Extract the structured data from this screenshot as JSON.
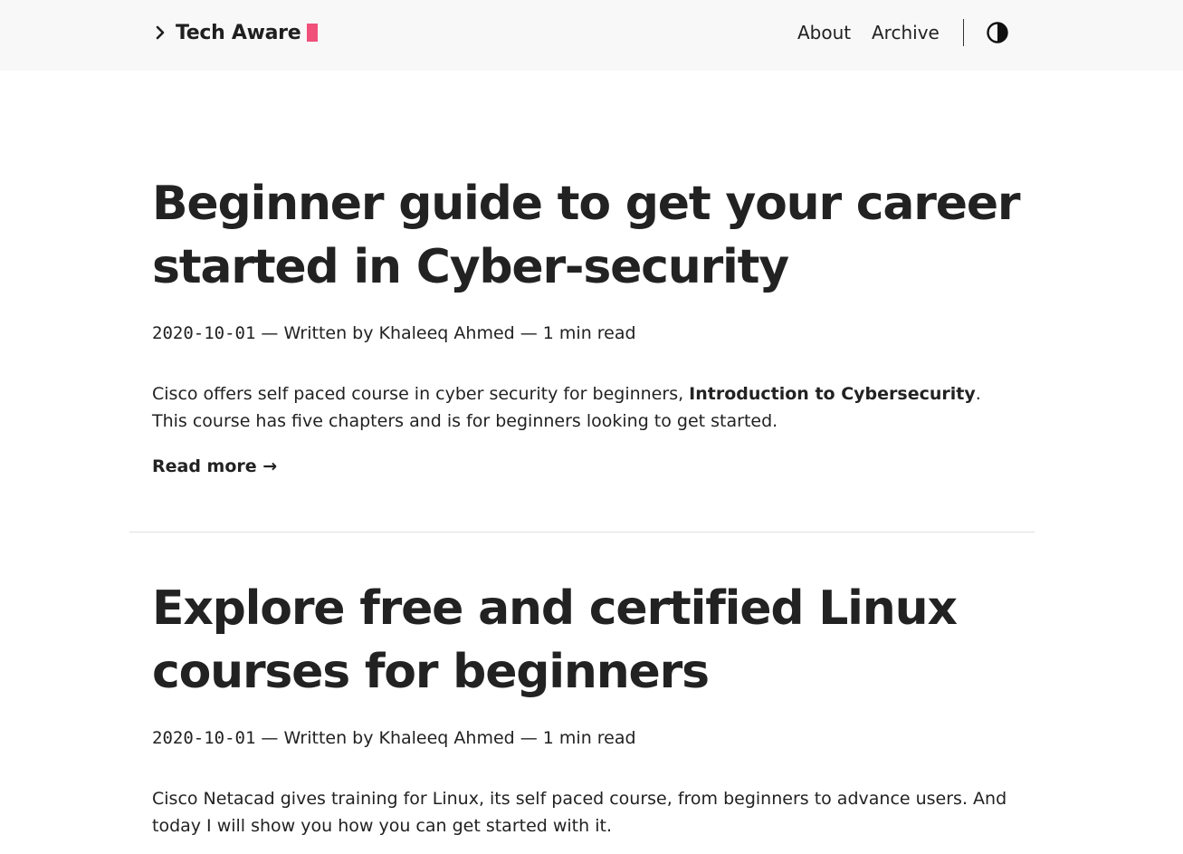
{
  "header": {
    "brand_name": "Tech Aware",
    "brand_icon": "chevron-right-icon",
    "accent_color": "#f0507a",
    "nav_items": [
      {
        "label": "About"
      },
      {
        "label": "Archive"
      }
    ],
    "theme_toggle_icon": "contrast-icon"
  },
  "posts": [
    {
      "title_line1": "Beginner guide to get your career",
      "title_line2": "started in Cyber-security",
      "date": "2020-10-01",
      "meta_rest": " — Written by Khaleeq Ahmed — 1 min read",
      "summary_part1": "Cisco offers self paced course in cyber security for beginners, ",
      "summary_bold": "Introduction to Cybersecurity",
      "summary_part2": ". This course has five chapters and is for beginners looking to get started.",
      "read_more": "Read more →"
    },
    {
      "title_line1": "Explore free and certified Linux",
      "title_line2": "courses for beginners",
      "date": "2020-10-01",
      "meta_rest": " — Written by Khaleeq Ahmed — 1 min read",
      "summary": "Cisco Netacad gives training for Linux, its self paced course, from beginners to advance users. And today I will show you how you can get started with it."
    }
  ]
}
